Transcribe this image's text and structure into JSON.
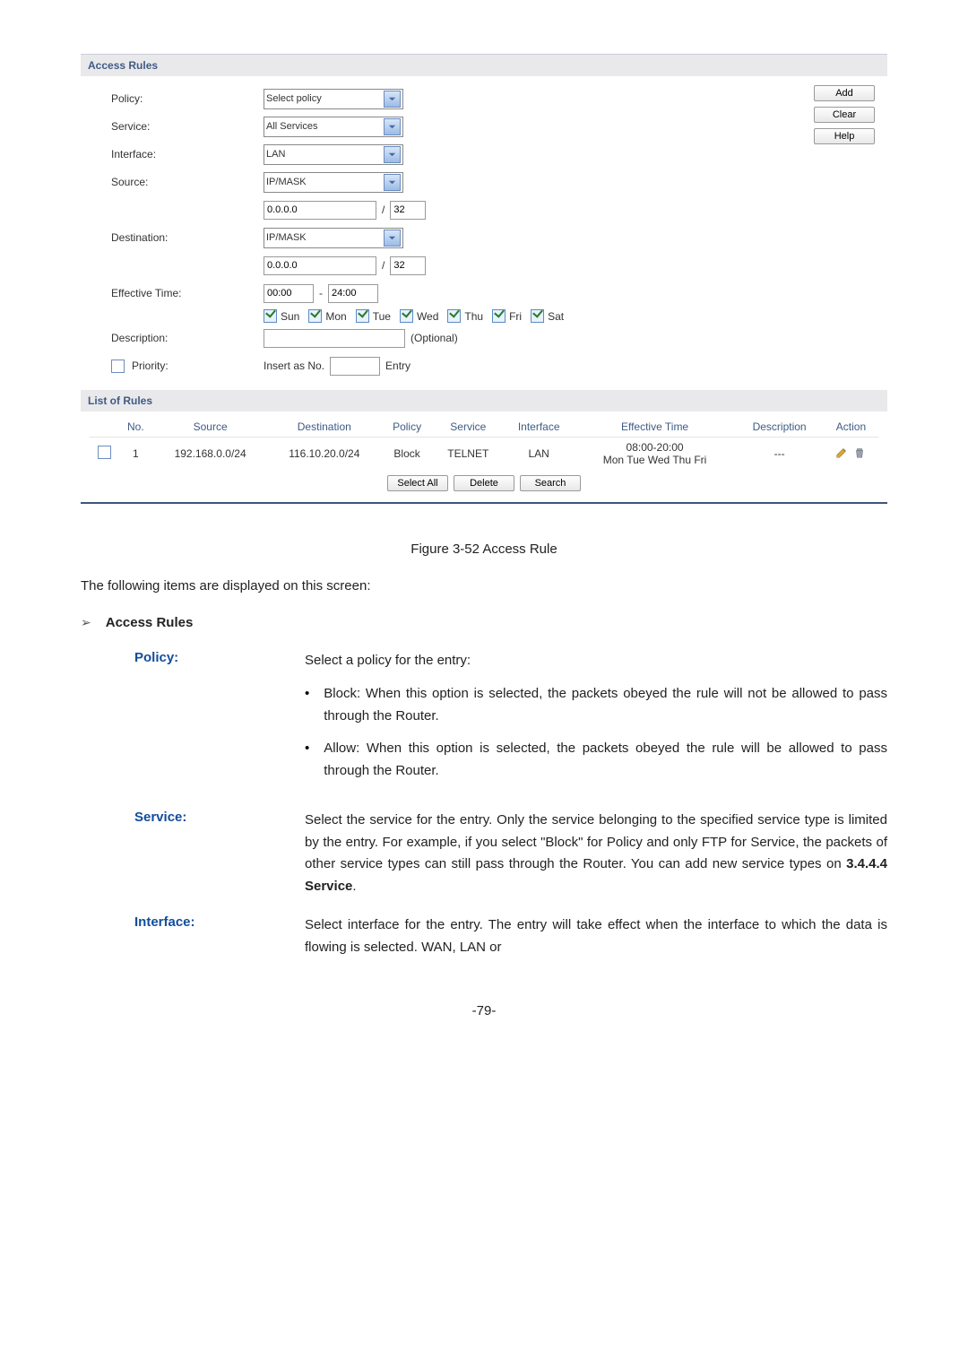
{
  "shot": {
    "section_access_rules": "Access Rules",
    "labels": {
      "policy": "Policy:",
      "service": "Service:",
      "interface": "Interface:",
      "source": "Source:",
      "destination": "Destination:",
      "effective_time": "Effective Time:",
      "description": "Description:",
      "priority": "Priority:"
    },
    "fields": {
      "policy_value": "Select policy",
      "service_value": "All Services",
      "interface_value": "LAN",
      "source_mode": "IP/MASK",
      "source_ip": "0.0.0.0",
      "source_mask": "32",
      "dest_mode": "IP/MASK",
      "dest_ip": "0.0.0.0",
      "dest_mask": "32",
      "time_from": "00:00",
      "time_to": "24:00",
      "time_dash": "-",
      "slash": "/",
      "days": [
        "Sun",
        "Mon",
        "Tue",
        "Wed",
        "Thu",
        "Fri",
        "Sat"
      ],
      "description_value": "",
      "description_opt": "(Optional)",
      "priority_prefix": "Insert as No.",
      "priority_value": "",
      "priority_suffix": "Entry"
    },
    "buttons": {
      "add": "Add",
      "clear": "Clear",
      "help": "Help",
      "select_all": "Select All",
      "delete": "Delete",
      "search": "Search"
    },
    "section_list": "List of Rules",
    "headers": {
      "no": "No.",
      "source": "Source",
      "destination": "Destination",
      "policy": "Policy",
      "service": "Service",
      "interface": "Interface",
      "effective_time": "Effective Time",
      "description": "Description",
      "action": "Action"
    },
    "row": {
      "no": "1",
      "source": "192.168.0.0/24",
      "destination": "116.10.20.0/24",
      "policy": "Block",
      "service": "TELNET",
      "interface": "LAN",
      "time1": "08:00-20:00",
      "time2": "Mon Tue Wed Thu Fri",
      "desc": "---"
    }
  },
  "doc": {
    "caption": "Figure 3-52 Access Rule",
    "intro": "The following items are displayed on this screen:",
    "heading": "Access Rules",
    "policy": {
      "term": "Policy:",
      "lead": "Select a policy for the entry:",
      "b1": "Block: When this option is selected, the packets obeyed the rule will not be allowed to pass through the Router.",
      "b2": "Allow: When this option is selected, the packets obeyed the rule will be allowed to pass through the Router."
    },
    "service": {
      "term": "Service:",
      "desc_a": "Select the service for the entry. Only the service belonging to the specified service type is limited by the entry. For example, if you select \"Block\" for Policy and only FTP for Service, the packets of other service types can still pass through the Router. You can add new service types on ",
      "desc_b": "3.4.4.4 Service",
      "desc_c": "."
    },
    "interface": {
      "term": "Interface:",
      "desc": "Select interface for the entry. The entry will take effect when the interface to which the data is flowing is selected. WAN, LAN or"
    },
    "footer": "-79-"
  }
}
